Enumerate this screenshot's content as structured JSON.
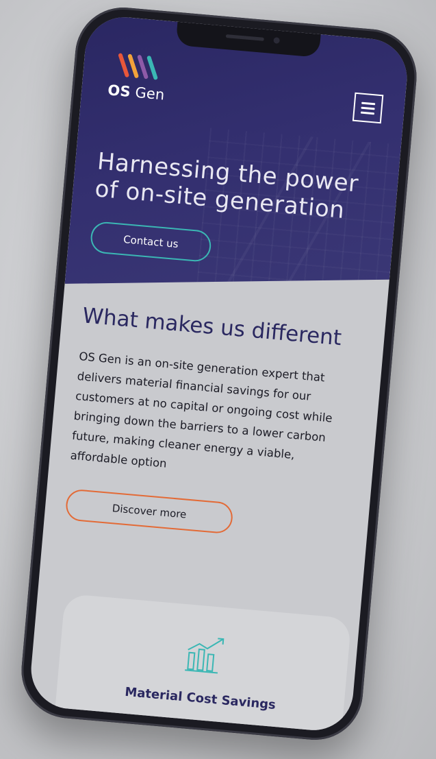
{
  "brand": {
    "name_bold": "OS",
    "name_regular": " Gen",
    "stripe_colors": [
      "#e8573a",
      "#f2a23a",
      "#8e5aa8",
      "#3bb7b4"
    ],
    "primary": "#2a2762",
    "accent_teal": "#3bb7b4",
    "accent_orange": "#e36a36"
  },
  "header": {
    "menu_icon": "hamburger-icon"
  },
  "hero": {
    "title": "Harnessing the power of on-site generation",
    "cta_label": "Contact us"
  },
  "about": {
    "title": "What makes us different",
    "body": "OS Gen is an on-site generation expert that delivers material financial savings for our customers at no capital or ongoing cost while bringing down the barriers to a lower carbon future, making cleaner energy a viable, affordable option",
    "cta_label": "Discover more"
  },
  "feature_card": {
    "icon": "chart-growth-icon",
    "title": "Material Cost Savings"
  }
}
